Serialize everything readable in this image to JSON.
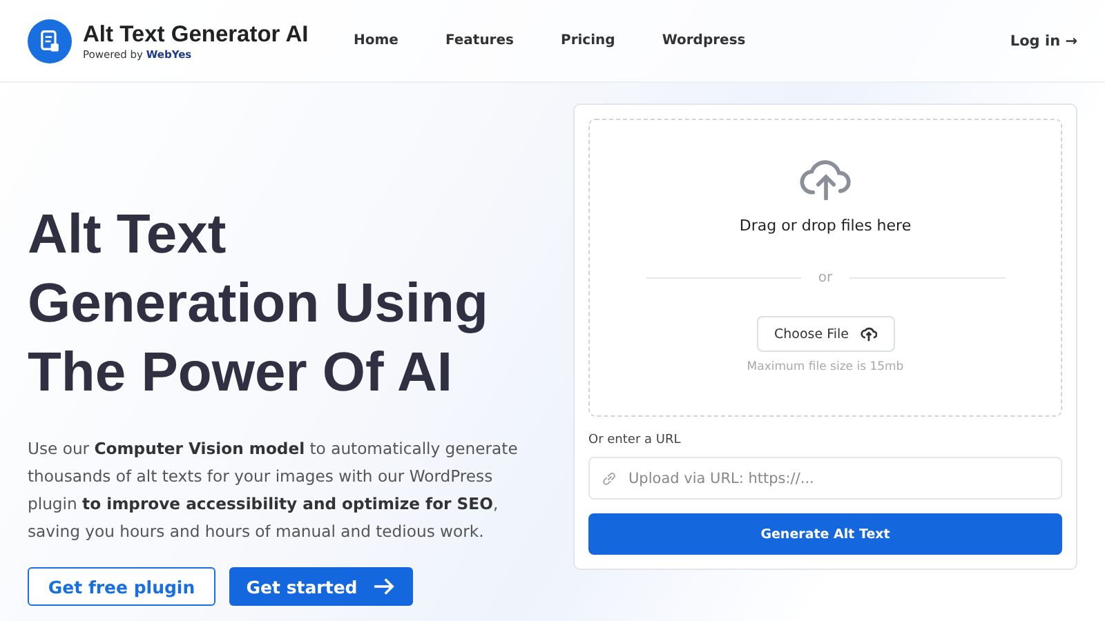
{
  "brand": {
    "title": "Alt Text Generator AI",
    "powered_by": "Powered by",
    "partner": "WebYes"
  },
  "nav": [
    {
      "label": "Home"
    },
    {
      "label": "Features"
    },
    {
      "label": "Pricing"
    },
    {
      "label": "Wordpress"
    }
  ],
  "login": "Log in →",
  "hero": {
    "headline_lines": [
      "Alt Text",
      "Generation Using",
      "The Power Of AI"
    ],
    "description": "Use our **Computer Vision model** to automatically generate thousands of alt texts for your images with our WordPress plugin **to improve accessibility and optimize for SEO**, saving you hours and hours of manual and tedious work.",
    "buttons": [
      {
        "label": "Get free plugin",
        "kind": "outline"
      },
      {
        "label": "Get started",
        "kind": "primary"
      }
    ]
  },
  "upload": {
    "drop_text": "Drag or drop files here",
    "separator": "or",
    "choose_button": "Choose File",
    "max_size": "Maximum file size is 15mb",
    "url_label": "Or enter a URL",
    "url_placeholder": "Upload via URL: https://...",
    "submit": "Generate Alt Text"
  }
}
